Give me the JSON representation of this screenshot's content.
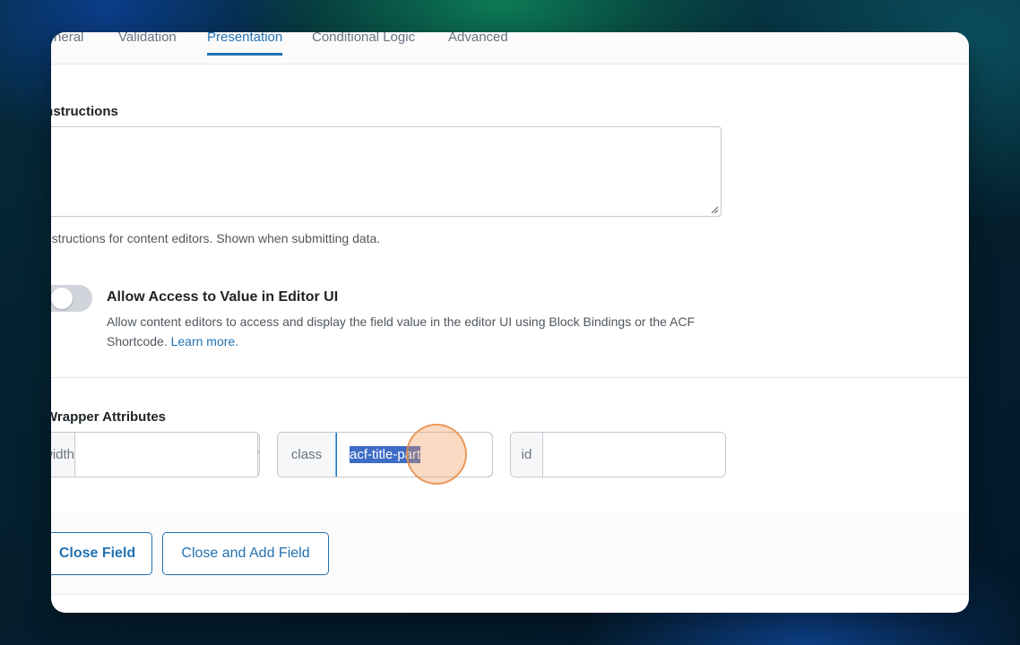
{
  "tabs": [
    {
      "label": "General"
    },
    {
      "label": "Validation"
    },
    {
      "label": "Presentation"
    },
    {
      "label": "Conditional Logic"
    },
    {
      "label": "Advanced"
    }
  ],
  "active_tab": "Presentation",
  "instructions": {
    "label": "Instructions",
    "value": "",
    "helper": "Instructions for content editors. Shown when submitting data."
  },
  "editor_access": {
    "title": "Allow Access to Value in Editor UI",
    "description": "Allow content editors to access and display the field value in the editor UI using Block Bindings or the ACF Shortcode.",
    "link": "Learn more.",
    "enabled": false
  },
  "wrapper": {
    "label": "Wrapper Attributes",
    "width_addon": "width",
    "width_value": "",
    "width_suffix": "%",
    "class_addon": "class",
    "class_value": "acf-title-part",
    "id_addon": "id",
    "id_value": ""
  },
  "buttons": {
    "close_field": "Close Field",
    "close_and_add": "Close and Add Field"
  },
  "colors": {
    "accent": "#2271b1",
    "selection": "#3e6cc7"
  }
}
